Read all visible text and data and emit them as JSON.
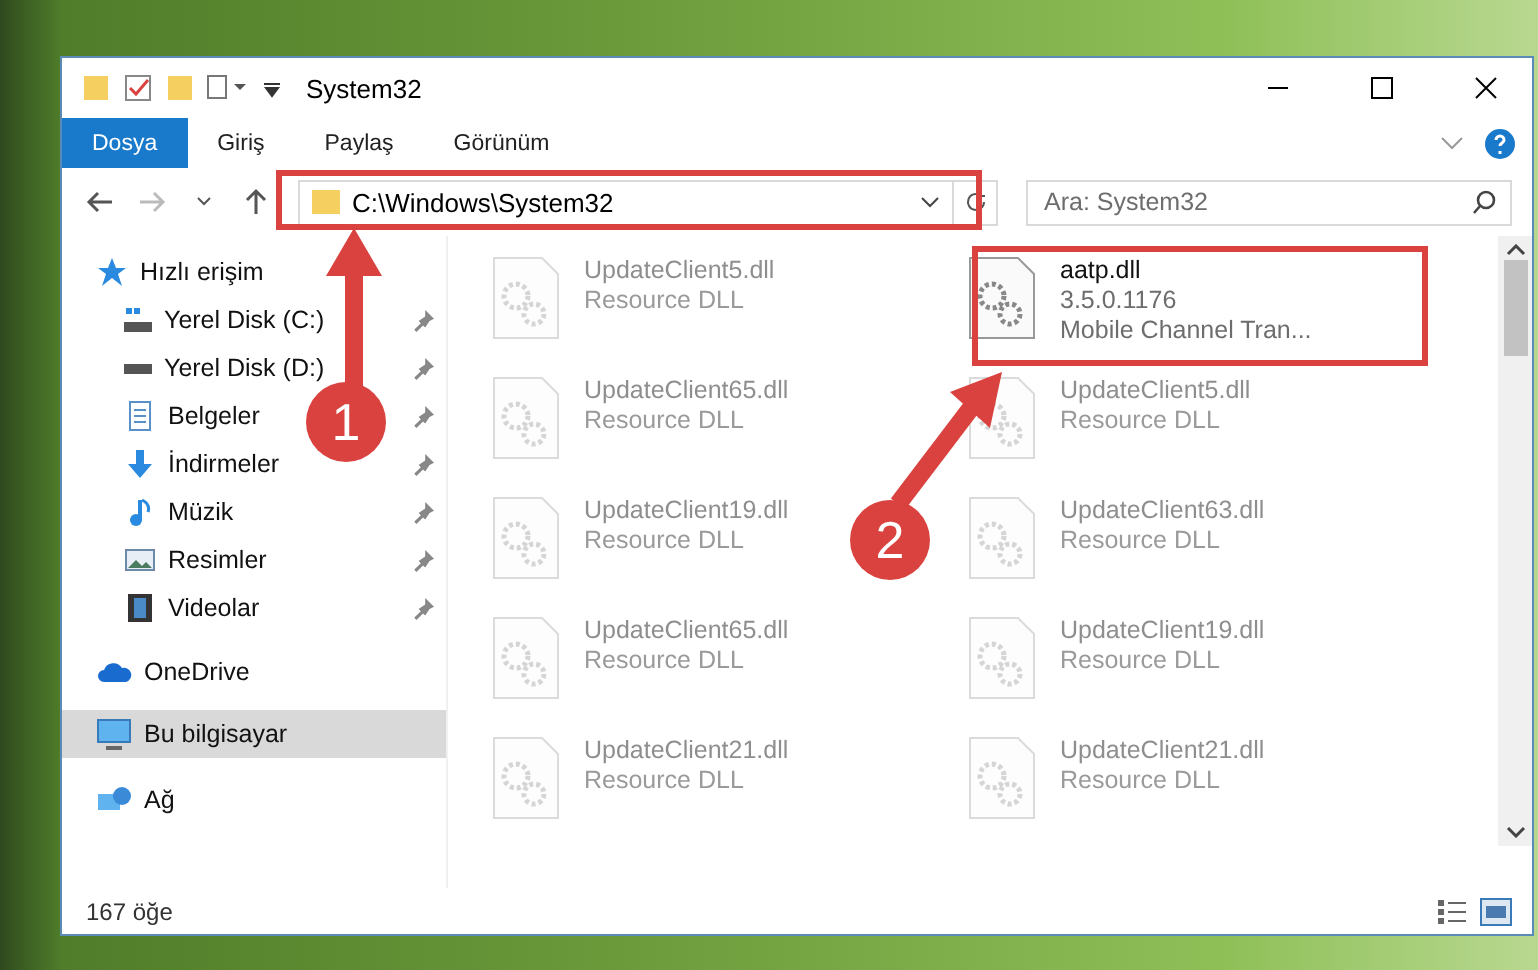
{
  "window": {
    "title": "System32"
  },
  "ribbon_tabs": [
    {
      "label": "Dosya",
      "selected": true
    },
    {
      "label": "Giriş",
      "selected": false
    },
    {
      "label": "Paylaş",
      "selected": false
    },
    {
      "label": "Görünüm",
      "selected": false
    }
  ],
  "address": {
    "path": "C:\\Windows\\System32"
  },
  "search": {
    "placeholder": "Ara: System32"
  },
  "sidebar": {
    "items": [
      {
        "label": "Hızlı erişim",
        "kind": "star",
        "selected": false,
        "children": [
          {
            "label": "Yerel Disk (C:)",
            "kind": "system-disk",
            "pinned": true
          },
          {
            "label": "Yerel Disk (D:)",
            "kind": "disk",
            "pinned": true
          },
          {
            "label": "Belgeler",
            "kind": "document",
            "pinned": true
          },
          {
            "label": "İndirmeler",
            "kind": "download",
            "pinned": true
          },
          {
            "label": "Müzik",
            "kind": "music",
            "pinned": true
          },
          {
            "label": "Resimler",
            "kind": "picture",
            "pinned": true
          },
          {
            "label": "Videolar",
            "kind": "video",
            "pinned": true
          }
        ]
      },
      {
        "label": "OneDrive",
        "kind": "cloud",
        "selected": false
      },
      {
        "label": "Bu bilgisayar",
        "kind": "computer",
        "selected": true
      },
      {
        "label": "Ağ",
        "kind": "network",
        "selected": false
      }
    ]
  },
  "files": [
    {
      "name": "UpdateClient5.dll",
      "line_2": "Resource DLL",
      "blurred": true
    },
    {
      "name": "aatp.dll",
      "line_2": "3.5.0.1176",
      "line_3": "Mobile Channel Tran...",
      "blurred": false
    },
    {
      "name": "UpdateClient65.dll",
      "line_2": "Resource DLL",
      "blurred": true
    },
    {
      "name": "UpdateClient5.dll",
      "line_2": "Resource DLL",
      "blurred": true
    },
    {
      "name": "UpdateClient19.dll",
      "line_2": "Resource DLL",
      "blurred": true
    },
    {
      "name": "UpdateClient63.dll",
      "line_2": "Resource DLL",
      "blurred": true
    },
    {
      "name": "UpdateClient65.dll",
      "line_2": "Resource DLL",
      "blurred": true
    },
    {
      "name": "UpdateClient19.dll",
      "line_2": "Resource DLL",
      "blurred": true
    },
    {
      "name": "UpdateClient21.dll",
      "line_2": "Resource DLL",
      "blurred": true
    },
    {
      "name": "UpdateClient21.dll",
      "line_2": "Resource DLL",
      "blurred": true
    }
  ],
  "status_bar": {
    "count": "167 öğe"
  },
  "annotations": [
    {
      "label": "1",
      "kind": "address"
    },
    {
      "label": "2",
      "kind": "file"
    }
  ]
}
